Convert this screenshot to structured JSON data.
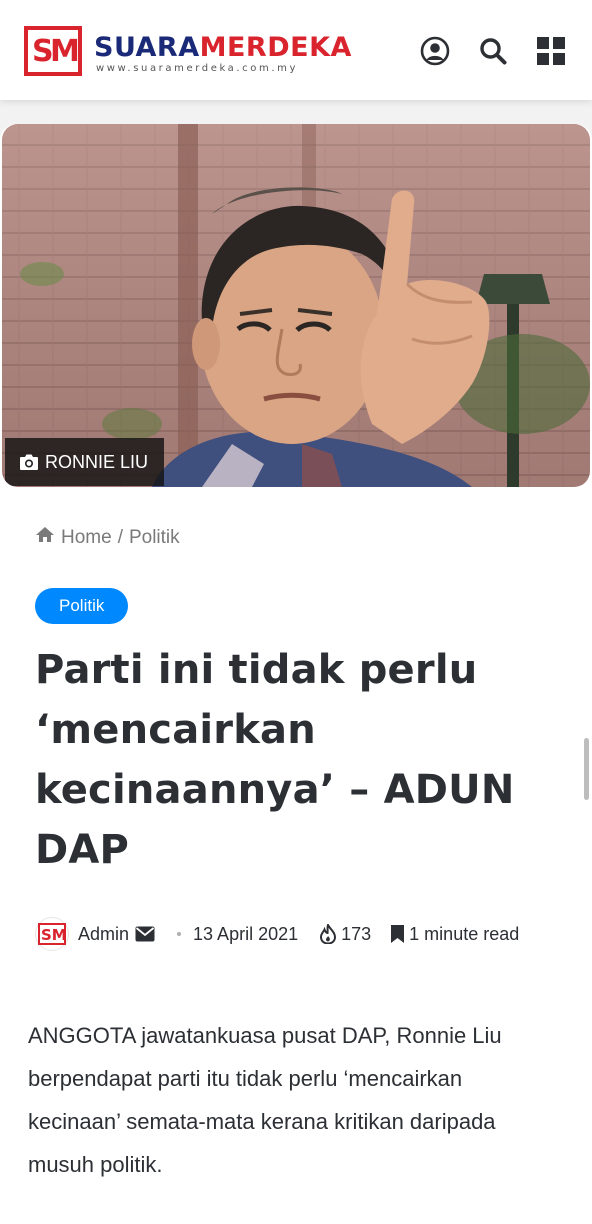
{
  "site": {
    "logo_letters_s": "S",
    "logo_letters_m": "M",
    "brand_part1": "SUARA",
    "brand_part2": "MERDEKA",
    "brand_url": "www.suaramerdeka.com.my"
  },
  "header_icons": [
    "user-icon",
    "search-icon",
    "menu-grid-icon"
  ],
  "hero": {
    "caption": "RONNIE LIU",
    "caption_icon": "camera-icon"
  },
  "breadcrumb": {
    "home": "Home",
    "separator": "/",
    "current": "Politik"
  },
  "category_tag": "Politik",
  "article": {
    "title": "Parti ini tidak perlu ‘mencairkan kecinaannya’ – ADUN DAP",
    "author": "Admin",
    "date": "13 April 2021",
    "views": "173",
    "read_time": "1 minute read",
    "lead": "ANGGOTA jawatankuasa pusat DAP, Ronnie Liu berpendapat parti itu tidak perlu ‘mencairkan kecinaan’ semata-mata kerana kritikan daripada musuh politik."
  },
  "colors": {
    "brand_red": "#d9232d",
    "brand_blue": "#1b2a78",
    "tag_blue": "#0088ff",
    "text_dark": "#2c2f34"
  }
}
